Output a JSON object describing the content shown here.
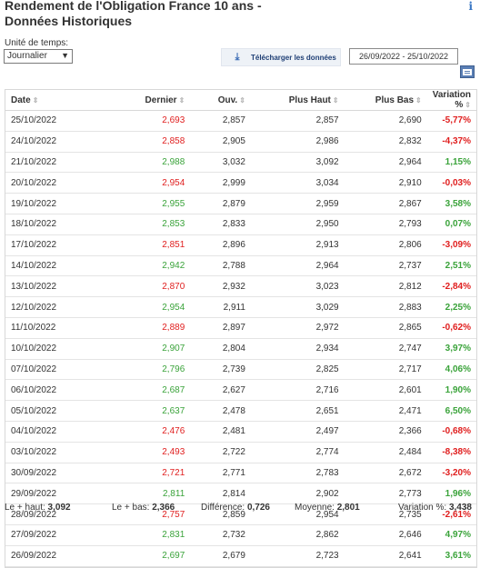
{
  "title_line1": "Rendement de l'Obligation France 10 ans -",
  "title_line2": "Données Historiques",
  "time_unit_label": "Unité de temps:",
  "time_unit_value": "Journalier",
  "download_label": "Télécharger les données",
  "date_range": "26/09/2022 - 25/10/2022",
  "columns": [
    "Date",
    "Dernier",
    "Ouv.",
    "Plus Haut",
    "Plus Bas",
    "Variation %"
  ],
  "colors": {
    "up": "#3aa33a",
    "down": "#e01e1e"
  },
  "rows": [
    {
      "date": "25/10/2022",
      "last": "2,693",
      "open": "2,857",
      "high": "2,857",
      "low": "2,690",
      "chg": "-5,77%",
      "dir": "down"
    },
    {
      "date": "24/10/2022",
      "last": "2,858",
      "open": "2,905",
      "high": "2,986",
      "low": "2,832",
      "chg": "-4,37%",
      "dir": "down"
    },
    {
      "date": "21/10/2022",
      "last": "2,988",
      "open": "3,032",
      "high": "3,092",
      "low": "2,964",
      "chg": "1,15%",
      "dir": "up"
    },
    {
      "date": "20/10/2022",
      "last": "2,954",
      "open": "2,999",
      "high": "3,034",
      "low": "2,910",
      "chg": "-0,03%",
      "dir": "down"
    },
    {
      "date": "19/10/2022",
      "last": "2,955",
      "open": "2,879",
      "high": "2,959",
      "low": "2,867",
      "chg": "3,58%",
      "dir": "up"
    },
    {
      "date": "18/10/2022",
      "last": "2,853",
      "open": "2,833",
      "high": "2,950",
      "low": "2,793",
      "chg": "0,07%",
      "dir": "up"
    },
    {
      "date": "17/10/2022",
      "last": "2,851",
      "open": "2,896",
      "high": "2,913",
      "low": "2,806",
      "chg": "-3,09%",
      "dir": "down"
    },
    {
      "date": "14/10/2022",
      "last": "2,942",
      "open": "2,788",
      "high": "2,964",
      "low": "2,737",
      "chg": "2,51%",
      "dir": "up"
    },
    {
      "date": "13/10/2022",
      "last": "2,870",
      "open": "2,932",
      "high": "3,023",
      "low": "2,812",
      "chg": "-2,84%",
      "dir": "down"
    },
    {
      "date": "12/10/2022",
      "last": "2,954",
      "open": "2,911",
      "high": "3,029",
      "low": "2,883",
      "chg": "2,25%",
      "dir": "up"
    },
    {
      "date": "11/10/2022",
      "last": "2,889",
      "open": "2,897",
      "high": "2,972",
      "low": "2,865",
      "chg": "-0,62%",
      "dir": "down"
    },
    {
      "date": "10/10/2022",
      "last": "2,907",
      "open": "2,804",
      "high": "2,934",
      "low": "2,747",
      "chg": "3,97%",
      "dir": "up"
    },
    {
      "date": "07/10/2022",
      "last": "2,796",
      "open": "2,739",
      "high": "2,825",
      "low": "2,717",
      "chg": "4,06%",
      "dir": "up"
    },
    {
      "date": "06/10/2022",
      "last": "2,687",
      "open": "2,627",
      "high": "2,716",
      "low": "2,601",
      "chg": "1,90%",
      "dir": "up"
    },
    {
      "date": "05/10/2022",
      "last": "2,637",
      "open": "2,478",
      "high": "2,651",
      "low": "2,471",
      "chg": "6,50%",
      "dir": "up"
    },
    {
      "date": "04/10/2022",
      "last": "2,476",
      "open": "2,481",
      "high": "2,497",
      "low": "2,366",
      "chg": "-0,68%",
      "dir": "down"
    },
    {
      "date": "03/10/2022",
      "last": "2,493",
      "open": "2,722",
      "high": "2,774",
      "low": "2,484",
      "chg": "-8,38%",
      "dir": "down"
    },
    {
      "date": "30/09/2022",
      "last": "2,721",
      "open": "2,771",
      "high": "2,783",
      "low": "2,672",
      "chg": "-3,20%",
      "dir": "down"
    },
    {
      "date": "29/09/2022",
      "last": "2,811",
      "open": "2,814",
      "high": "2,902",
      "low": "2,773",
      "chg": "1,96%",
      "dir": "up"
    },
    {
      "date": "28/09/2022",
      "last": "2,757",
      "open": "2,859",
      "high": "2,954",
      "low": "2,735",
      "chg": "-2,61%",
      "dir": "down"
    },
    {
      "date": "27/09/2022",
      "last": "2,831",
      "open": "2,732",
      "high": "2,862",
      "low": "2,646",
      "chg": "4,97%",
      "dir": "up"
    },
    {
      "date": "26/09/2022",
      "last": "2,697",
      "open": "2,679",
      "high": "2,723",
      "low": "2,641",
      "chg": "3,61%",
      "dir": "up"
    }
  ],
  "footer": {
    "high_label": "Le + haut:",
    "high_value": "3,092",
    "low_label": "Le + bas:",
    "low_value": "2,366",
    "diff_label": "Différence:",
    "diff_value": "0,726",
    "avg_label": "Moyenne:",
    "avg_value": "2,801",
    "var_label": "Variation %:",
    "var_value": "3,438"
  }
}
